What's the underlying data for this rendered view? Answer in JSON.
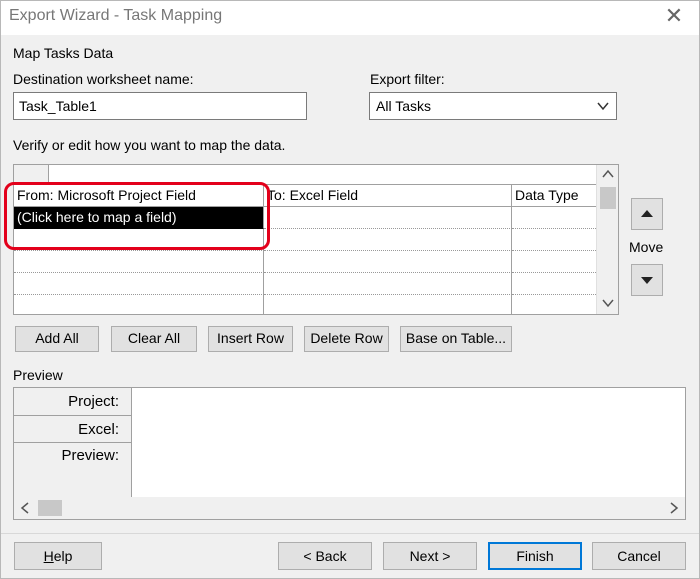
{
  "window": {
    "title": "Export Wizard - Task Mapping",
    "close_glyph": "✕"
  },
  "section": {
    "title": "Map Tasks Data"
  },
  "destination": {
    "label": "Destination worksheet name:",
    "value": "Task_Table1"
  },
  "filter": {
    "label": "Export filter:",
    "value": "All Tasks"
  },
  "grid": {
    "instruction": "Verify or edit how you want to map the data.",
    "headers": [
      "From: Microsoft Project Field",
      "To:  Excel Field",
      "Data Type"
    ],
    "rows": [
      [
        "(Click here to map a field)",
        "",
        ""
      ],
      [
        "",
        "",
        ""
      ],
      [
        "",
        "",
        ""
      ],
      [
        "",
        "",
        ""
      ],
      [
        "",
        "",
        ""
      ]
    ]
  },
  "move": {
    "label": "Move"
  },
  "actions": {
    "add_all": "Add All",
    "clear_all": "Clear All",
    "insert_row": "Insert Row",
    "delete_row": "Delete Row",
    "base_on_table": "Base on Table..."
  },
  "preview": {
    "label": "Preview",
    "rows": [
      "Project:",
      "Excel:",
      "Preview:"
    ]
  },
  "footer": {
    "help_first": "H",
    "help_rest": "elp",
    "back": "< Back",
    "next": "Next >",
    "finish": "Finish",
    "cancel": "Cancel"
  },
  "colors": {
    "highlight": "#e3001b",
    "selection": "#000000",
    "focus": "#0078d7"
  }
}
